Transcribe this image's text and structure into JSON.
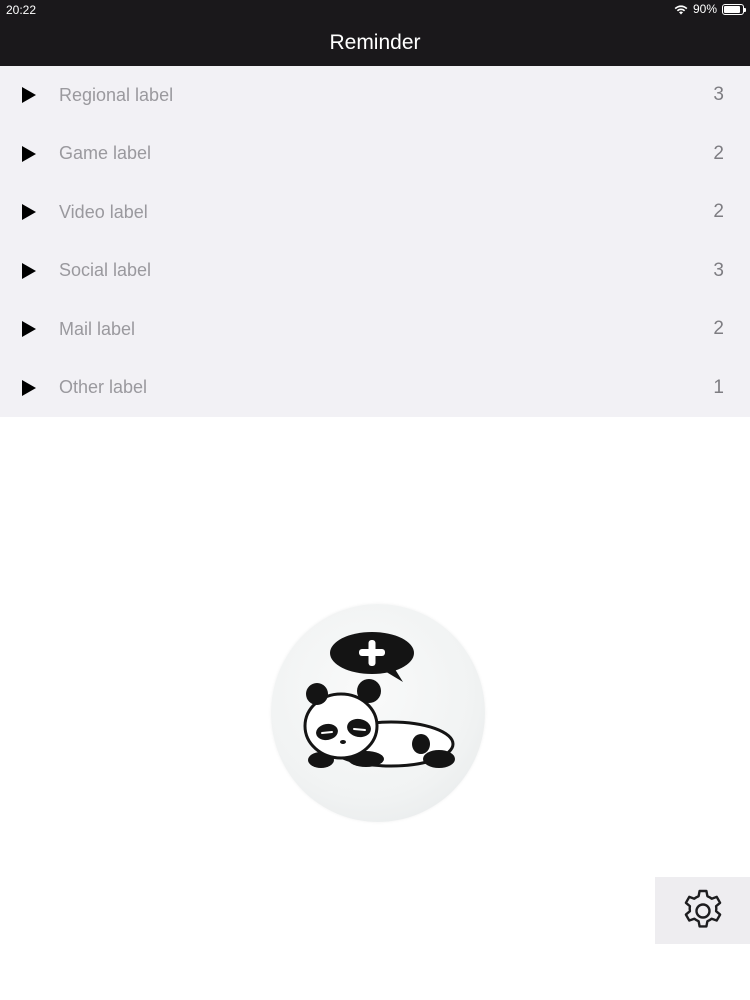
{
  "status_bar": {
    "time": "20:22",
    "battery": "90%",
    "battery_level": 0.9
  },
  "nav": {
    "title": "Reminder"
  },
  "labels": [
    {
      "label": "Regional label",
      "count": "3"
    },
    {
      "label": "Game label",
      "count": "2"
    },
    {
      "label": "Video label",
      "count": "2"
    },
    {
      "label": "Social label",
      "count": "3"
    },
    {
      "label": "Mail label",
      "count": "2"
    },
    {
      "label": "Other label",
      "count": "1"
    }
  ],
  "icons": {
    "row_expand": "play-triangle-icon",
    "add": "panda-add-icon",
    "settings": "gear-icon",
    "wifi": "wifi-icon",
    "battery": "battery-icon"
  },
  "colors": {
    "bar_background": "#1a181b",
    "list_background": "#f2f1f5",
    "label_text": "#9a999e",
    "count_text": "#7e7d82"
  }
}
